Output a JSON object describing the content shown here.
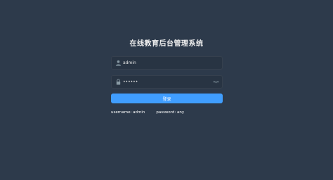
{
  "login": {
    "title": "在线教育后台管理系统",
    "username": {
      "value": "admin",
      "icon": "user-icon"
    },
    "password": {
      "value": "••••••",
      "icon": "lock-icon",
      "toggle_icon": "eye-closed-icon"
    },
    "submit_label": "登录",
    "tips": {
      "username": "username: admin",
      "password": "password: any"
    }
  },
  "colors": {
    "background": "#2d3a4b",
    "input_bg": "#283443",
    "accent": "#409eff",
    "text": "#eeeeee"
  }
}
